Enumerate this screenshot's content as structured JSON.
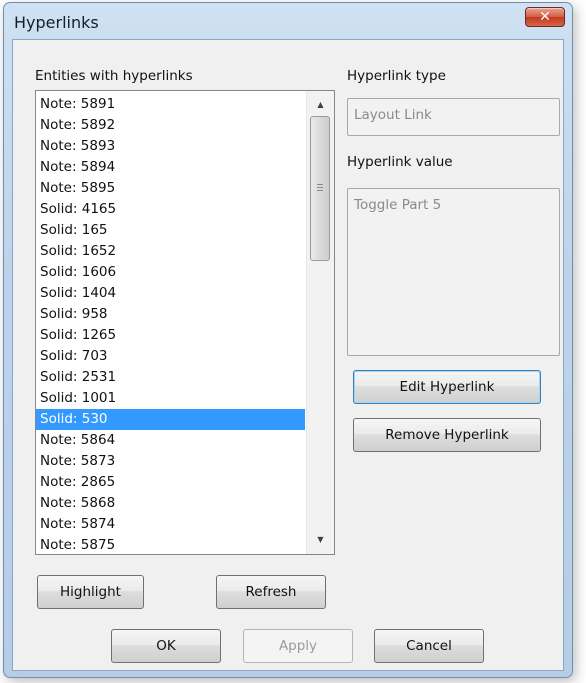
{
  "window": {
    "title": "Hyperlinks",
    "close_label": "✕"
  },
  "entities": {
    "label": "Entities with hyperlinks",
    "items": [
      "Note: 5891",
      "Note: 5892",
      "Note: 5893",
      "Note: 5894",
      "Note: 5895",
      "Solid: 4165",
      "Solid: 165",
      "Solid: 1652",
      "Solid: 1606",
      "Solid: 1404",
      "Solid: 958",
      "Solid: 1265",
      "Solid: 703",
      "Solid: 2531",
      "Solid: 1001",
      "Solid: 530",
      "Note: 5864",
      "Note: 5873",
      "Note: 2865",
      "Note: 5868",
      "Note: 5874",
      "Note: 5875"
    ],
    "selected_item": "Solid: 530",
    "scroll_up_glyph": "▲",
    "scroll_down_glyph": "▼"
  },
  "hyperlink_type": {
    "label": "Hyperlink type",
    "value": "Layout Link"
  },
  "hyperlink_value": {
    "label": "Hyperlink value",
    "value": "Toggle Part 5"
  },
  "buttons": {
    "edit": "Edit Hyperlink",
    "remove": "Remove Hyperlink",
    "highlight": "Highlight",
    "refresh": "Refresh",
    "ok": "OK",
    "apply": "Apply",
    "cancel": "Cancel"
  },
  "colors": {
    "selection": "#3399ff",
    "title_bar": "#bcd3eb",
    "close_button": "#c23a1f"
  }
}
